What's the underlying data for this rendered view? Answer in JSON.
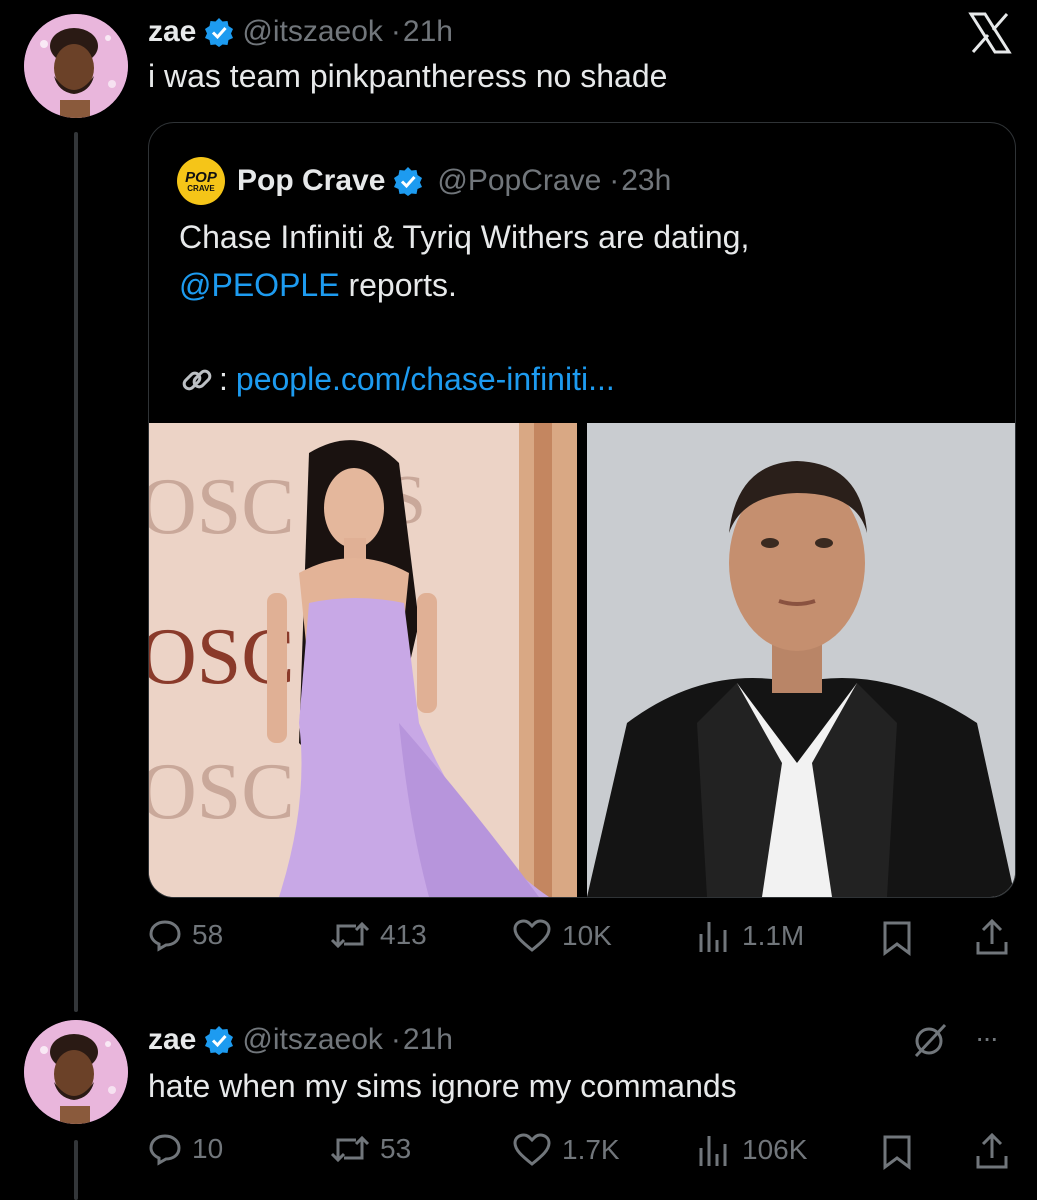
{
  "tweet1": {
    "name": "zae",
    "handle": "@itszaeok",
    "dot": "·",
    "time": "21h",
    "text": "i was team pinkpantheress no shade"
  },
  "quote": {
    "name": "Pop Crave",
    "handle": "@PopCrave",
    "dot": "·",
    "time": "23h",
    "logo_line1": "POP",
    "logo_line2": "CRAVE",
    "text_line1": "Chase Infiniti & Tyriq Withers are dating,",
    "mention": "@PEOPLE",
    "text_line2_rest": " reports.",
    "link_prefix": ":",
    "link_text": "people.com/chase-infiniti...",
    "photo_sign_letters": [
      "OSC",
      "S",
      "OSC",
      "OSC"
    ]
  },
  "tweet1_stats": {
    "replies": "58",
    "retweets": "413",
    "likes": "10K",
    "views": "1.1M"
  },
  "tweet2": {
    "name": "zae",
    "handle": "@itszaeok",
    "dot": "·",
    "time": "21h",
    "text": "hate when my sims ignore my commands",
    "more": "···"
  },
  "tweet2_stats": {
    "replies": "10",
    "retweets": "53",
    "likes": "1.7K",
    "views": "106K"
  },
  "colors": {
    "background": "#000000",
    "text": "#e7e9ea",
    "muted": "#71767b",
    "link": "#1d9bf0",
    "verified": "#1d9bf0",
    "border": "#2f3336"
  }
}
